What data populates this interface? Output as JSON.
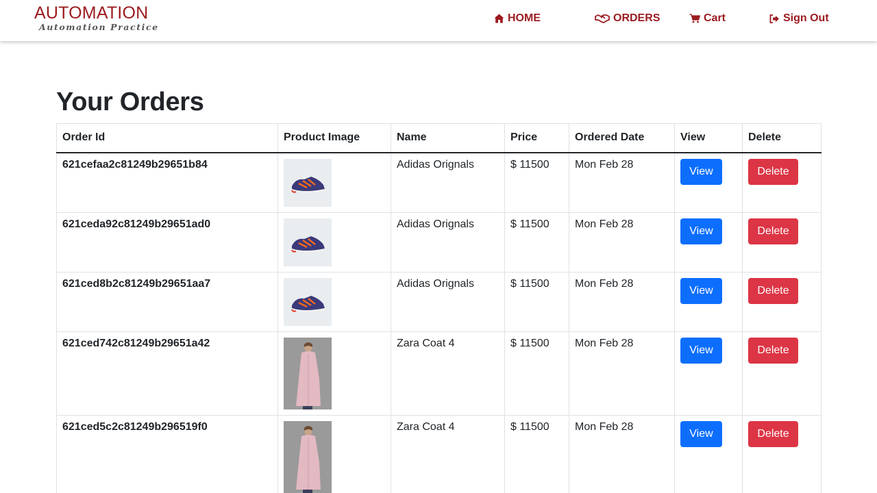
{
  "brand": {
    "title": "AUTOMATION",
    "subtitle": "Automation Practice"
  },
  "nav": {
    "home": {
      "label": "HOME",
      "icon": "home-icon"
    },
    "orders": {
      "label": "ORDERS",
      "icon": "handshake-icon"
    },
    "cart": {
      "label": "Cart",
      "icon": "cart-icon"
    },
    "signout": {
      "label": "Sign Out",
      "icon": "sign-out-icon"
    }
  },
  "page": {
    "title": "Your Orders"
  },
  "table": {
    "headers": {
      "order_id": "Order Id",
      "image": "Product Image",
      "name": "Name",
      "price": "Price",
      "date": "Ordered Date",
      "view": "View",
      "delete": "Delete"
    },
    "rows": [
      {
        "order_id": "621cefaa2c81249b29651b84",
        "image": "sneaker-image",
        "name": "Adidas Orignals",
        "price": "$ 11500",
        "date": "Mon Feb 28",
        "view_label": "View",
        "delete_label": "Delete"
      },
      {
        "order_id": "621ceda92c81249b29651ad0",
        "image": "sneaker-image",
        "name": "Adidas Orignals",
        "price": "$ 11500",
        "date": "Mon Feb 28",
        "view_label": "View",
        "delete_label": "Delete"
      },
      {
        "order_id": "621ced8b2c81249b29651aa7",
        "image": "sneaker-image",
        "name": "Adidas Orignals",
        "price": "$ 11500",
        "date": "Mon Feb 28",
        "view_label": "View",
        "delete_label": "Delete"
      },
      {
        "order_id": "621ced742c81249b29651a42",
        "image": "coat-image",
        "name": "Zara Coat 4",
        "price": "$ 11500",
        "date": "Mon Feb 28",
        "view_label": "View",
        "delete_label": "Delete"
      },
      {
        "order_id": "621ced5c2c81249b296519f0",
        "image": "coat-image",
        "name": "Zara Coat 4",
        "price": "$ 11500",
        "date": "Mon Feb 28",
        "view_label": "View",
        "delete_label": "Delete"
      }
    ]
  },
  "colors": {
    "brand": "#9b1b1f",
    "view_button": "#0d6efd",
    "delete_button": "#dc3545"
  }
}
